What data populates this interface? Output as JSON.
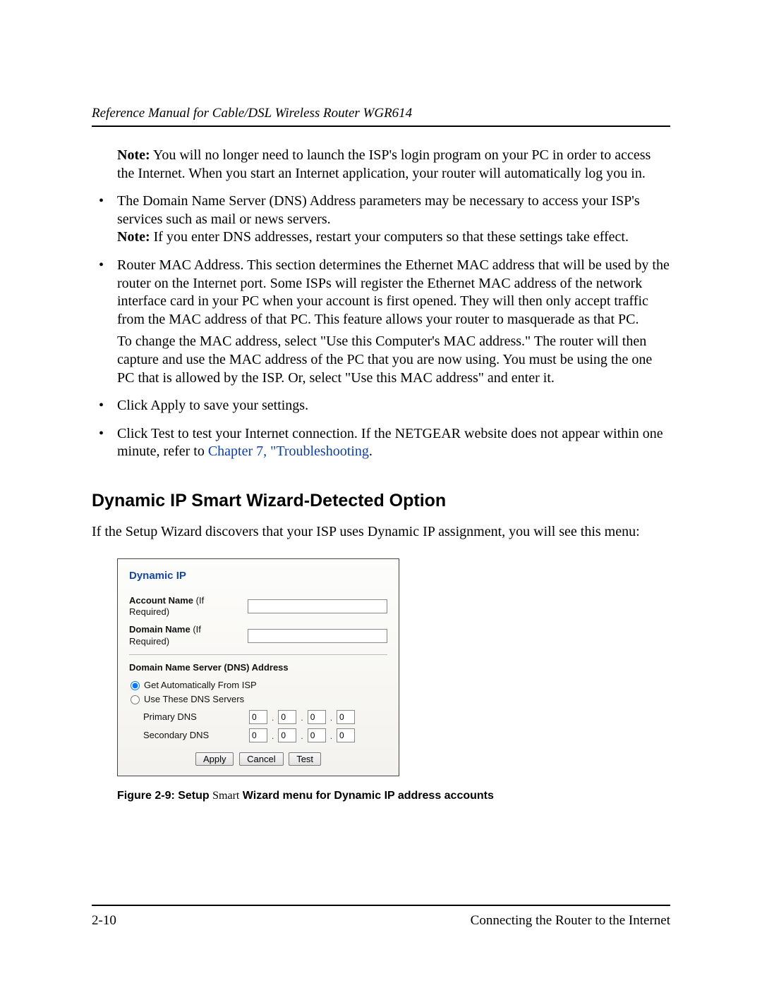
{
  "header": {
    "title": "Reference Manual for Cable/DSL Wireless Router WGR614"
  },
  "content": {
    "note1_label": "Note:",
    "note1_text": " You will no longer need to launch the ISP's login program on your PC in order to access the Internet. When you start an Internet application, your router will automatically log you in.",
    "bullet1_a": "The Domain Name Server (DNS) Address parameters may be necessary to access your ISP's services such as mail or news servers.",
    "bullet1_note_label": "Note:",
    "bullet1_note_text": " If you enter DNS addresses, restart your computers so that these settings take effect.",
    "bullet2_a": "Router MAC Address. This section determines the Ethernet MAC address that will be used by the router on the Internet port. Some ISPs will register the Ethernet MAC address of the network interface card in your PC when your account is first opened. They will then only accept traffic from the MAC address of that PC. This feature allows your router to masquerade as that PC.",
    "bullet2_b": "To change the MAC address, select \"Use this Computer's MAC address.\" The router will then capture and use the MAC address of the PC that you are now using. You must be using the one PC that is allowed by the ISP. Or, select \"Use this MAC address\" and enter it.",
    "bullet3": "Click Apply to save your settings.",
    "bullet4_a": "Click Test to test your Internet connection. If the NETGEAR website does not appear within one minute, refer to ",
    "bullet4_link": "Chapter 7, \"Troubleshooting",
    "bullet4_after": "."
  },
  "section": {
    "heading": "Dynamic IP Smart Wizard-Detected Option",
    "intro": "If the Setup Wizard discovers that your ISP uses Dynamic IP assignment, you will see this menu:"
  },
  "figure": {
    "title": "Dynamic IP",
    "account_label_bold": "Account Name",
    "account_label_paren": " (If Required)",
    "account_value": "",
    "domain_label_bold": "Domain Name",
    "domain_label_paren": " (If Required)",
    "domain_value": "",
    "dns_heading": "Domain Name Server (DNS) Address",
    "radio_auto": "Get Automatically From ISP",
    "radio_manual": "Use These DNS Servers",
    "primary_label": "Primary DNS",
    "secondary_label": "Secondary DNS",
    "primary": [
      "0",
      "0",
      "0",
      "0"
    ],
    "secondary": [
      "0",
      "0",
      "0",
      "0"
    ],
    "btn_apply": "Apply",
    "btn_cancel": "Cancel",
    "btn_test": "Test"
  },
  "caption": {
    "prefix": "Figure 2-9:  Setup ",
    "mid": "Smart",
    "suffix": " Wizard menu for Dynamic IP address accounts"
  },
  "footer": {
    "page_num": "2-10",
    "chapter": "Connecting the Router to the Internet"
  }
}
